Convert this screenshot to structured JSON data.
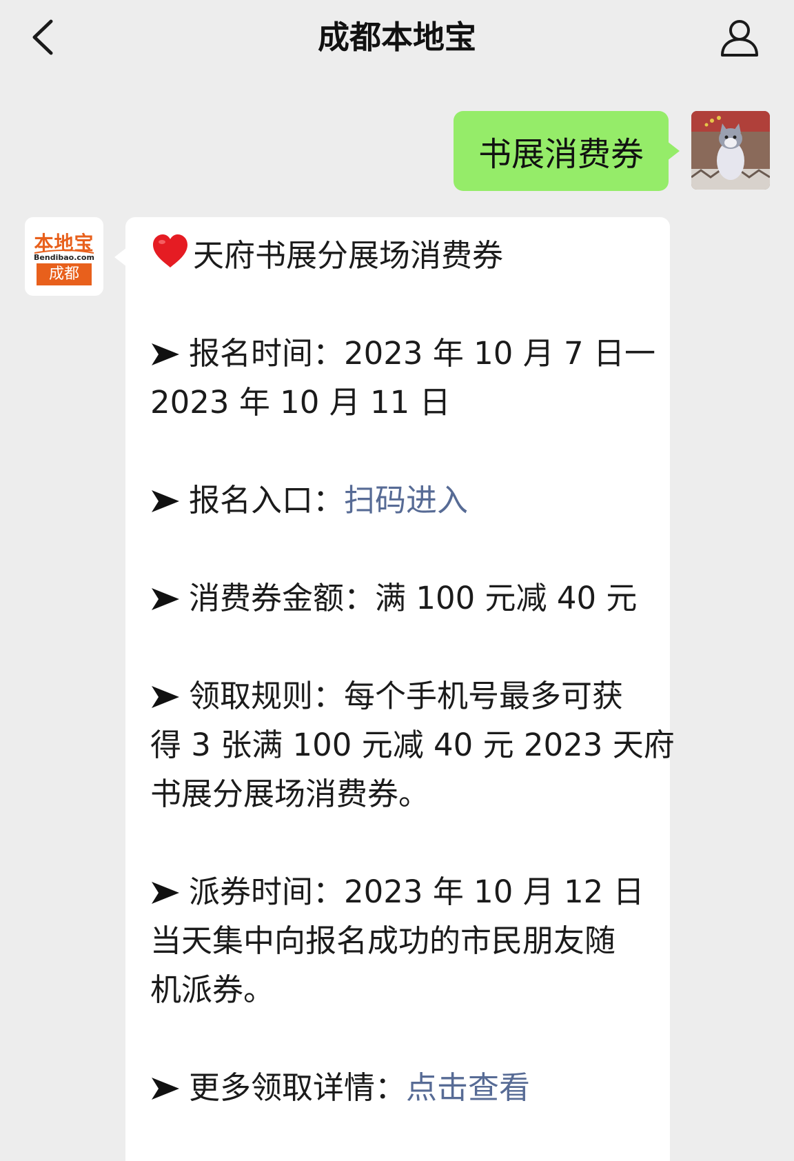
{
  "header": {
    "title": "成都本地宝"
  },
  "chat": {
    "outgoing_message": "书展消费券",
    "sender_logo": {
      "top": "本地宝",
      "mid": "Bendibao.com",
      "bottom": "成都"
    },
    "incoming": {
      "heading": "天府书展分展场消费券",
      "reg_time_label": "报名时间：",
      "reg_time_l1": "2023 年 10 月 7 日一",
      "reg_time_l2": "2023 年 10 月 11 日",
      "entry_label": "报名入口：",
      "entry_link": "扫码进入",
      "amount_label": "消费券金额：",
      "amount_value": "满 100 元减 40 元",
      "rule_l1_label": "领取规则：",
      "rule_l1_text": "每个手机号最多可获",
      "rule_l2": "得 3 张满 100 元减 40 元 2023 天府",
      "rule_l3": "书展分展场消费券。",
      "dist_label": "派券时间：",
      "dist_l1_text": "2023 年 10 月 12 日",
      "dist_l2": "当天集中向报名成功的市民朋友随",
      "dist_l3": "机派券。",
      "more_label": "更多领取详情：",
      "more_link": "点击查看"
    }
  },
  "colors": {
    "background": "#ededed",
    "outgoing_bubble": "#95ec69",
    "incoming_bubble": "#ffffff",
    "link": "#576b95",
    "brand_orange": "#e8601c"
  },
  "icons": {
    "back": "chevron-left-icon",
    "profile": "person-icon",
    "heart": "red-heart-icon",
    "arrow": "arrow-right-icon"
  }
}
